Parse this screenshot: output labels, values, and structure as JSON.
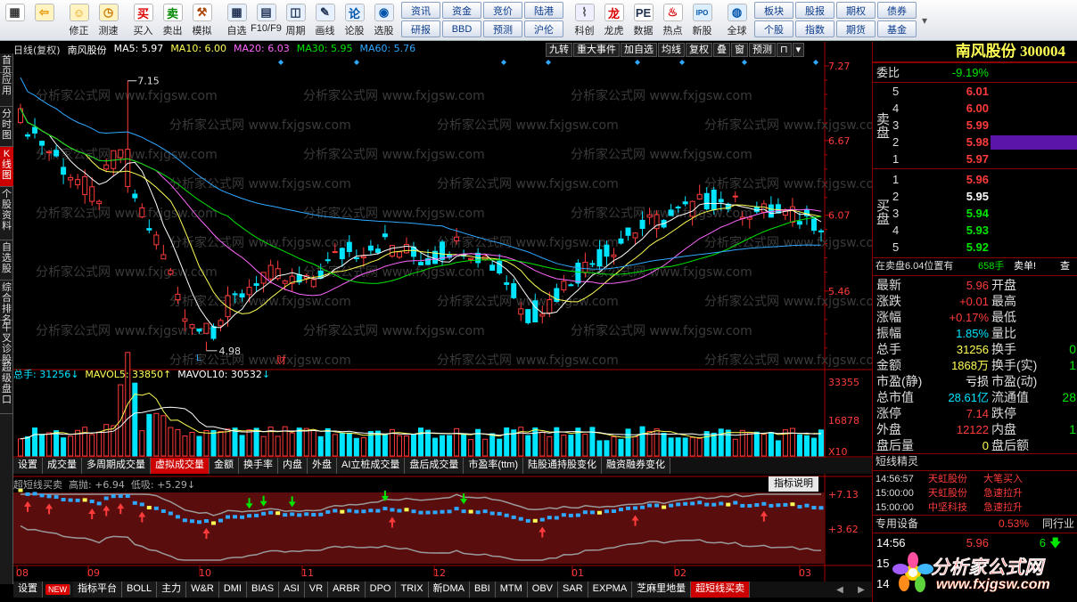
{
  "toolbar": {
    "left_buttons": [
      {
        "label": "",
        "icon": "grid-icon"
      },
      {
        "label": "",
        "icon": "back-icon"
      },
      {
        "label": "修正",
        "icon": "fix-icon"
      },
      {
        "label": "测速",
        "icon": "speed-icon"
      },
      {
        "label": "买入",
        "icon": "buy-icon"
      },
      {
        "label": "卖出",
        "icon": "sell-icon"
      },
      {
        "label": "模拟",
        "icon": "simulate-icon"
      },
      {
        "label": "自选",
        "icon": "watchlist-icon"
      },
      {
        "label": "F10/F9",
        "icon": "f10-icon"
      },
      {
        "label": "周期",
        "icon": "period-icon"
      },
      {
        "label": "画线",
        "icon": "draw-icon"
      },
      {
        "label": "论股",
        "icon": "discuss-icon"
      },
      {
        "label": "选股",
        "icon": "stock-pick-icon"
      }
    ],
    "small_buttons_1": [
      "资讯",
      "研报",
      "资金",
      "BBD",
      "竞价",
      "预测",
      "陆港",
      "沪伦"
    ],
    "mid_buttons": [
      {
        "label": "科创",
        "icon": "star-market-icon"
      },
      {
        "label": "龙虎",
        "icon": "dragon-tiger-icon"
      },
      {
        "label": "数据",
        "icon": "pe-data-icon"
      },
      {
        "label": "热点",
        "icon": "hot-icon"
      },
      {
        "label": "新股",
        "icon": "ipo-icon"
      },
      {
        "label": "全球",
        "icon": "globe-icon"
      }
    ],
    "small_buttons_2": [
      "板块",
      "个股",
      "股报",
      "指数",
      "期权",
      "期货",
      "债券",
      "基金"
    ]
  },
  "left_nav": [
    "首页",
    "应用",
    "分时图",
    "K线图",
    "个股资料",
    "自选股",
    "综合排名",
    "牛叉诊股",
    "超级盘口"
  ],
  "chart_header": {
    "period": "日线(复权)",
    "name": "南风股份",
    "ma5": "MA5: 5.97",
    "ma10": "MA10: 6.00",
    "ma20": "MA20: 6.03",
    "ma30": "MA30: 5.95",
    "ma60": "MA60: 5.76"
  },
  "tool_strip": [
    "九转",
    "重大事件",
    "加自选",
    "均线",
    "复权",
    "叠",
    "窗",
    "预测",
    "⊓",
    "▾"
  ],
  "price_axis": [
    "7.27",
    "6.67",
    "6.07",
    "5.46"
  ],
  "annotations": {
    "high": "7.15",
    "low": "4.98",
    "cai": "财"
  },
  "volume_header": {
    "total": "总手: 31256",
    "mavol5": "MAVOL5: 33850",
    "mavol10": "MAVOL10: 30532"
  },
  "volume_axis": [
    "33355",
    "16878",
    "X10"
  ],
  "mid_tabs": [
    "设置",
    "成交量",
    "多周期成交量",
    "虚拟成交量",
    "金额",
    "换手率",
    "内盘",
    "外盘",
    "AI立桩成交量",
    "盘后成交量",
    "市盈率(ttm)",
    "陆股通持股变化",
    "融资融券变化"
  ],
  "mid_tab_active": "虚拟成交量",
  "indicator_header": {
    "name": "超短线买卖",
    "high": "高抛: +6.94",
    "low": "低吸: +5.29",
    "button": "指标说明"
  },
  "indicator_axis": [
    "+7.13",
    "+3.62"
  ],
  "date_axis": [
    "08",
    "09",
    "10",
    "11",
    "12",
    "01",
    "02",
    "03"
  ],
  "bottom_tabs": [
    "设置",
    "NEW",
    "指标平台",
    "BOLL",
    "主力",
    "W&R",
    "DMI",
    "BIAS",
    "ASI",
    "VR",
    "ARBR",
    "DPO",
    "TRIX",
    "新DMA",
    "BBI",
    "MTM",
    "OBV",
    "SAR",
    "EXPMA",
    "芝麻里地量",
    "超短线买卖"
  ],
  "bottom_tab_active": "超短线买卖",
  "quote": {
    "title": "南风股份 300004",
    "weibi_label": "委比",
    "weibi_value": "-9.19%",
    "sell_label": "卖盘",
    "buy_label": "买盘",
    "asks": [
      {
        "level": "5",
        "price": "6.01"
      },
      {
        "level": "4",
        "price": "6.00"
      },
      {
        "level": "3",
        "price": "5.99"
      },
      {
        "level": "2",
        "price": "5.98"
      },
      {
        "level": "1",
        "price": "5.97"
      }
    ],
    "bids": [
      {
        "level": "1",
        "price": "5.96"
      },
      {
        "level": "2",
        "price": "5.95"
      },
      {
        "level": "3",
        "price": "5.94"
      },
      {
        "level": "4",
        "price": "5.93"
      },
      {
        "level": "5",
        "price": "5.92"
      }
    ],
    "note_left": "在卖盘6.04位置有",
    "note_mid": "658手",
    "note_right": "卖单!",
    "note_link": "查",
    "stats": [
      {
        "l": "最新",
        "v": "5.96",
        "c": "red",
        "l2": "开盘",
        "v2": ""
      },
      {
        "l": "涨跌",
        "v": "+0.01",
        "c": "red",
        "l2": "最高",
        "v2": ""
      },
      {
        "l": "涨幅",
        "v": "+0.17%",
        "c": "red",
        "l2": "最低",
        "v2": ""
      },
      {
        "l": "振幅",
        "v": "1.85%",
        "c": "cyan",
        "l2": "量比",
        "v2": ""
      },
      {
        "l": "总手",
        "v": "31256",
        "c": "yellow",
        "l2": "换手",
        "v2": "0"
      },
      {
        "l": "金额",
        "v": "1868万",
        "c": "yellow",
        "l2": "换手(实)",
        "v2": "1"
      },
      {
        "l": "市盈(静)",
        "v": "亏损",
        "c": "white",
        "l2": "市盈(动)",
        "v2": ""
      },
      {
        "l": "总市值",
        "v": "28.61亿",
        "c": "cyan",
        "l2": "流通值",
        "v2": "28"
      },
      {
        "l": "涨停",
        "v": "7.14",
        "c": "red",
        "l2": "跌停",
        "v2": ""
      },
      {
        "l": "外盘",
        "v": "12122",
        "c": "red",
        "l2": "内盘",
        "v2": "1"
      },
      {
        "l": "盘后量",
        "v": "0",
        "c": "yellow",
        "l2": "盘后额",
        "v2": ""
      }
    ],
    "elf_title": "短线精灵",
    "elf": [
      {
        "time": "14:56:57",
        "name": "天虹股份",
        "event": "大笔买入"
      },
      {
        "time": "15:00:00",
        "name": "天虹股份",
        "event": "急速拉升"
      },
      {
        "time": "15:00:00",
        "name": "中坚科技",
        "event": "急速拉升"
      }
    ],
    "special_label": "专用设备",
    "special_pct": "0.53%",
    "special_right": "同行业",
    "tick_time": "14:56",
    "tick_price": "5.96",
    "tick_vol": "6",
    "tick_times_more": [
      "15",
      "14"
    ]
  },
  "watermark": "分析家公式网 www.fxjgsw.com",
  "logo": {
    "cn": "分析家公式网",
    "url": "www.fxjgsw.com"
  },
  "colors": {
    "up": "#ff3b3b",
    "down": "#00e5ff",
    "ma5": "#ffffff",
    "ma10": "#ffff54",
    "ma20": "#ff66ff",
    "ma30": "#00e600",
    "ma60": "#2fa8ff",
    "indicator_bg": "#5a0d0d"
  }
}
